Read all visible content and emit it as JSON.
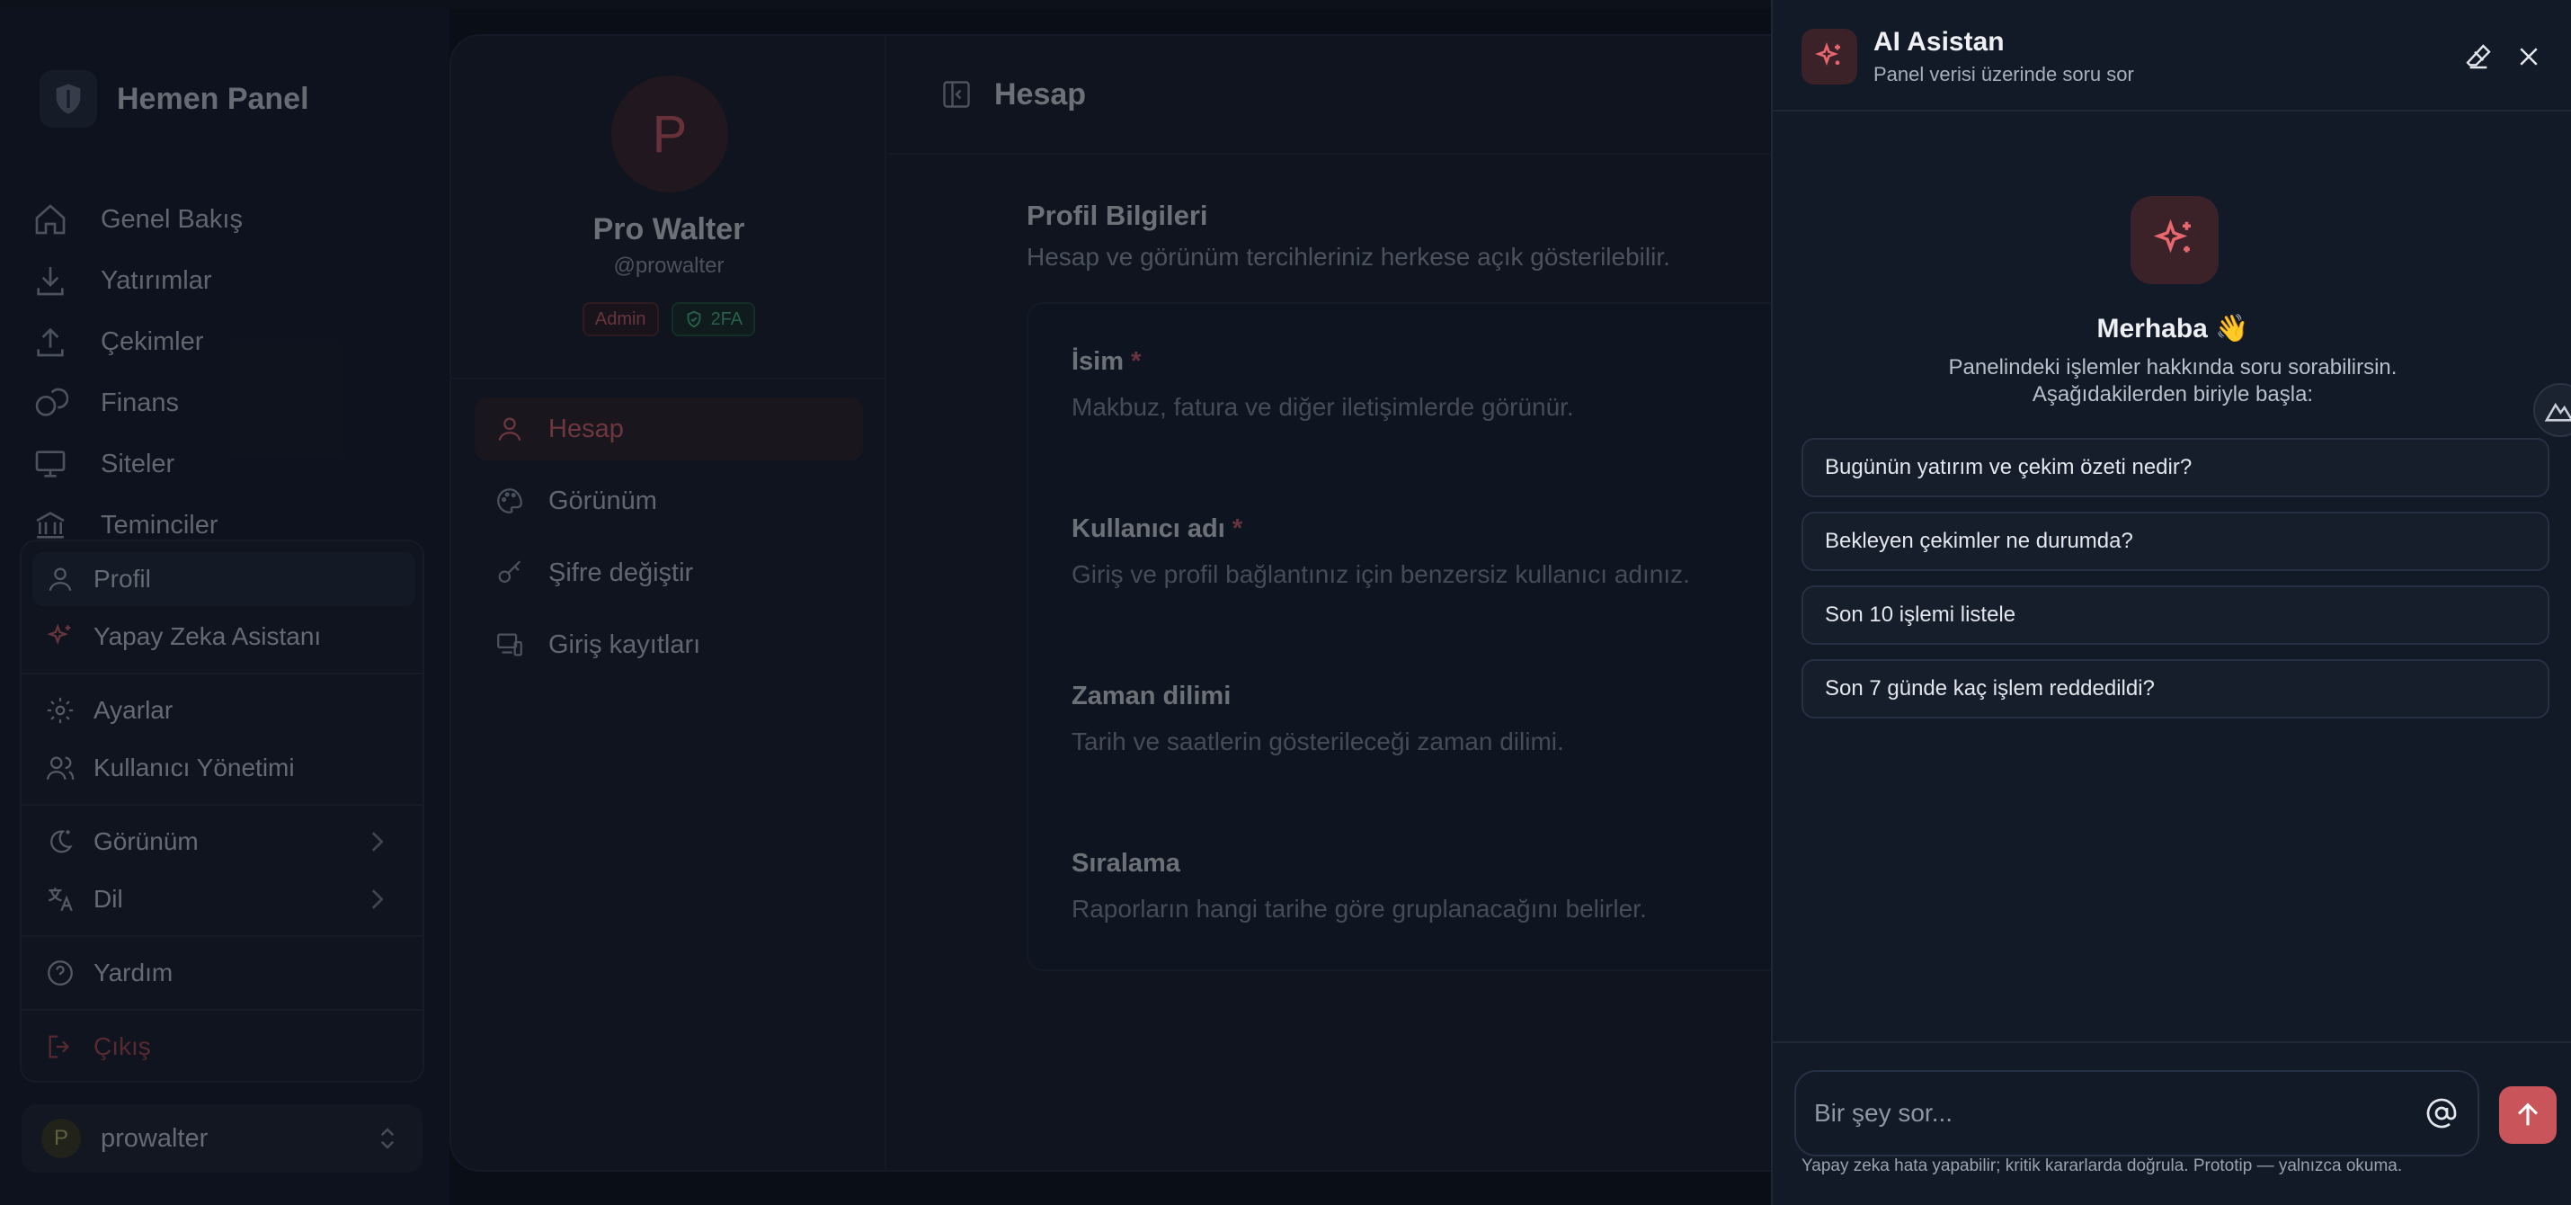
{
  "brand": {
    "name": "Hemen Panel"
  },
  "sidebar": {
    "items": [
      {
        "label": "Genel Bakış",
        "icon": "home-icon"
      },
      {
        "label": "Yatırımlar",
        "icon": "download-icon"
      },
      {
        "label": "Çekimler",
        "icon": "upload-icon"
      },
      {
        "label": "Finans",
        "icon": "coins-icon"
      },
      {
        "label": "Siteler",
        "icon": "monitor-icon"
      },
      {
        "label": "Teminciler",
        "icon": "bank-icon"
      }
    ]
  },
  "user_menu": {
    "profile": "Profil",
    "ai_assistant": "Yapay Zeka Asistanı",
    "settings": "Ayarlar",
    "user_management": "Kullanıcı Yönetimi",
    "appearance": "Görünüm",
    "language": "Dil",
    "help": "Yardım",
    "logout": "Çıkış"
  },
  "user": {
    "initial": "P",
    "username": "prowalter"
  },
  "profile": {
    "initial": "P",
    "name": "Pro Walter",
    "handle": "@prowalter",
    "badge_admin": "Admin",
    "badge_2fa": "2FA",
    "subnav": [
      "Hesap",
      "Görünüm",
      "Şifre değiştir",
      "Giriş kayıtları"
    ]
  },
  "content": {
    "header_title": "Hesap",
    "section_title": "Profil Bilgileri",
    "section_desc": "Hesap ve görünüm tercihleriniz herkese açık gösterilebilir.",
    "fields": [
      {
        "label": "İsim",
        "required": "*",
        "desc": "Makbuz, fatura ve diğer iletişimlerde görünür."
      },
      {
        "label": "Kullanıcı adı",
        "required": "*",
        "desc": "Giriş ve profil bağlantınız için benzersiz kullanıcı adınız."
      },
      {
        "label": "Zaman dilimi",
        "required": "",
        "desc": "Tarih ve saatlerin gösterileceği zaman dilimi."
      },
      {
        "label": "Sıralama",
        "required": "",
        "desc": "Raporların hangi tarihe göre gruplanacağını belirler."
      }
    ]
  },
  "ai": {
    "title": "AI Asistan",
    "subtitle": "Panel verisi üzerinde soru sor",
    "greeting": "Merhaba 👋",
    "greeting_line1": "Panelindeki işlemler hakkında soru sorabilirsin.",
    "greeting_line2": "Aşağıdakilerden biriyle başla:",
    "suggestions": [
      "Bugünün yatırım ve çekim özeti nedir?",
      "Bekleyen çekimler ne durumda?",
      "Son 10 işlemi listele",
      "Son 7 günde kaç işlem reddedildi?"
    ],
    "input_placeholder": "Bir şey sor...",
    "disclaimer": "Yapay zeka hata yapabilir; kritik kararlarda doğrula. Prototip — yalnızca okuma."
  },
  "colors": {
    "accent": "#c95459",
    "success": "#4bc58a",
    "background": "#0b0f17",
    "panel": "#121a27"
  }
}
